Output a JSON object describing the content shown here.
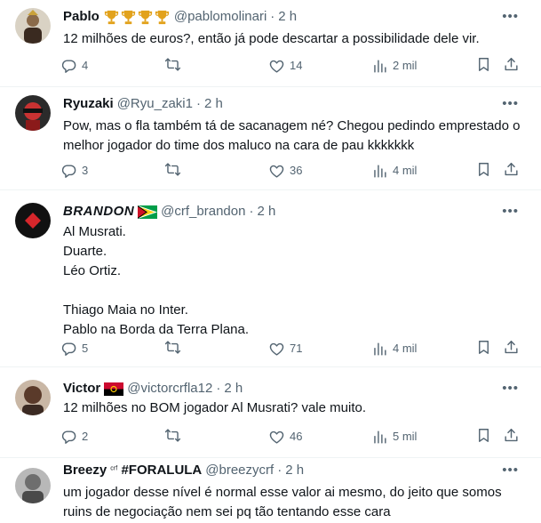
{
  "tweets": [
    {
      "name": "Pablo",
      "badge": "🏆🏆🏆🏆",
      "handle": "@pablomolinari",
      "time": "2 h",
      "text": "12 milhões de euros?, então já pode descartar a possibilidade dele vir.",
      "replies": "4",
      "retweets": "",
      "likes": "14",
      "views": "2 mil"
    },
    {
      "name": "Ryuzaki",
      "handle": "@Ryu_zaki1",
      "time": "2 h",
      "text": "Pow, mas o fla também tá de sacanagem né? Chegou pedindo emprestado o melhor jogador do time dos maluco na cara de pau kkkkkkk",
      "replies": "3",
      "retweets": "",
      "likes": "36",
      "views": "4 mil"
    },
    {
      "name": "BRANDON",
      "handle": "@crf_brandon",
      "time": "2 h",
      "text": "Al Musrati.\nDuarte.\nLéo Ortiz.\n\nThiago Maia no Inter.\nPablo na Borda da Terra Plana.",
      "replies": "5",
      "retweets": "",
      "likes": "71",
      "views": "4 mil"
    },
    {
      "name": "Victor",
      "handle": "@victorcrfla12",
      "time": "2 h",
      "text": "12 milhões no BOM jogador Al Musrati? vale muito.",
      "replies": "2",
      "retweets": "",
      "likes": "46",
      "views": "5 mil"
    },
    {
      "name": "Breezy",
      "name_suffix": "ᶜʳᶠ",
      "name_tag": "#FORALULA",
      "handle": "@breezycrf",
      "time": "2 h",
      "text": "um jogador desse nível é normal esse valor ai mesmo, do jeito que somos ruins de negociação nem sei pq tão tentando esse cara"
    }
  ],
  "ui": {
    "separator": "·",
    "more_glyph": "•••"
  },
  "colors": {
    "text": "#0f1419",
    "secondary": "#536471",
    "divider": "#eff3f4"
  },
  "icons": [
    "reply-icon",
    "retweet-icon",
    "like-icon",
    "views-icon",
    "bookmark-icon",
    "share-icon",
    "more-icon",
    "angola-flag-icon",
    "guyana-flag-icon",
    "trophy-icon"
  ]
}
